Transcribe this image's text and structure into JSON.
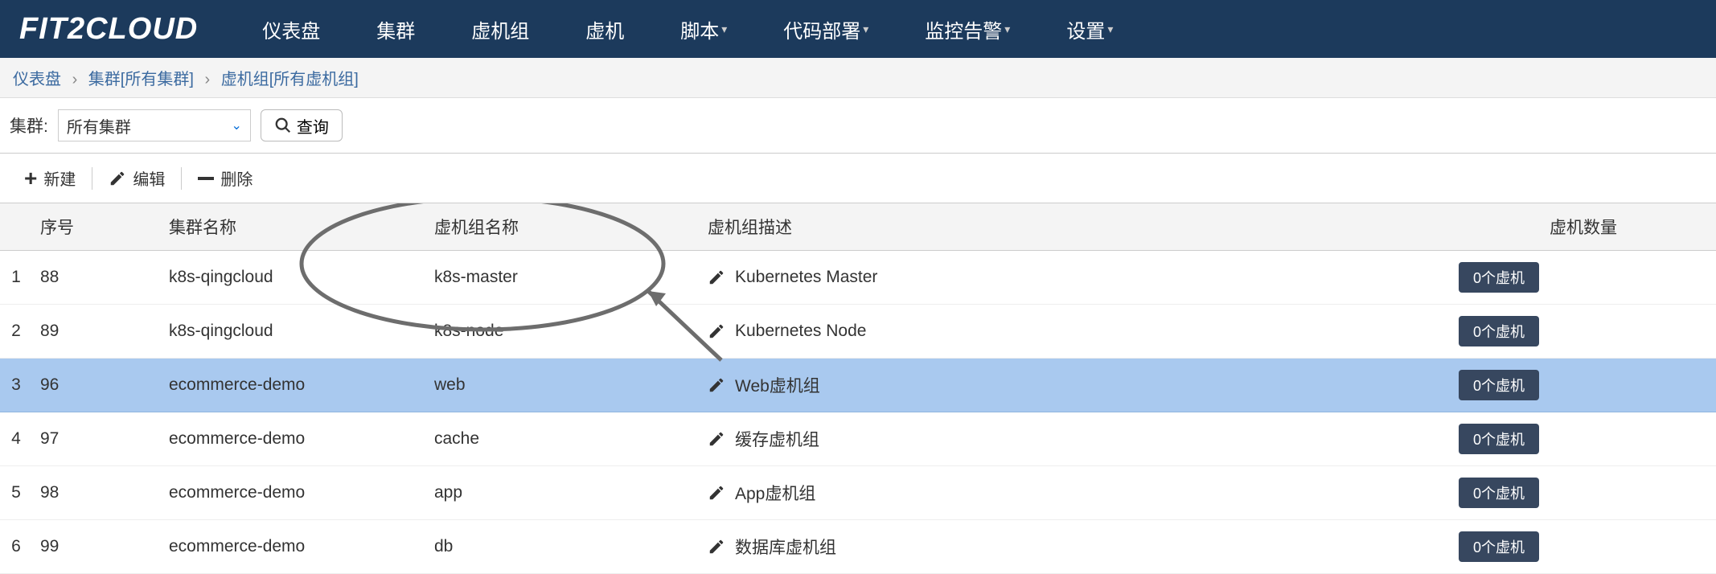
{
  "brand": "FIT2CLOUD",
  "nav": [
    "仪表盘",
    "集群",
    "虚机组",
    "虚机",
    "脚本",
    "代码部署",
    "监控告警",
    "设置"
  ],
  "nav_dropdowns": [
    false,
    false,
    false,
    false,
    true,
    true,
    true,
    true
  ],
  "breadcrumb": [
    "仪表盘",
    "集群[所有集群]",
    "虚机组[所有虚机组]"
  ],
  "filter": {
    "label": "集群:",
    "selected": "所有集群",
    "search_btn": "查询"
  },
  "toolbar": {
    "new": "新建",
    "edit": "编辑",
    "delete": "删除"
  },
  "columns": {
    "seq": "序号",
    "cluster": "集群名称",
    "vmgroup": "虚机组名称",
    "desc": "虚机组描述",
    "count": "虚机数量"
  },
  "rows": [
    {
      "idx": "1",
      "seq": "88",
      "cluster": "k8s-qingcloud",
      "vmgroup": "k8s-master",
      "desc": "Kubernetes Master",
      "count": "0个虚机",
      "selected": false
    },
    {
      "idx": "2",
      "seq": "89",
      "cluster": "k8s-qingcloud",
      "vmgroup": "k8s-node",
      "desc": "Kubernetes Node",
      "count": "0个虚机",
      "selected": false
    },
    {
      "idx": "3",
      "seq": "96",
      "cluster": "ecommerce-demo",
      "vmgroup": "web",
      "desc": "Web虚机组",
      "count": "0个虚机",
      "selected": true
    },
    {
      "idx": "4",
      "seq": "97",
      "cluster": "ecommerce-demo",
      "vmgroup": "cache",
      "desc": "缓存虚机组",
      "count": "0个虚机",
      "selected": false
    },
    {
      "idx": "5",
      "seq": "98",
      "cluster": "ecommerce-demo",
      "vmgroup": "app",
      "desc": "App虚机组",
      "count": "0个虚机",
      "selected": false
    },
    {
      "idx": "6",
      "seq": "99",
      "cluster": "ecommerce-demo",
      "vmgroup": "db",
      "desc": "数据库虚机组",
      "count": "0个虚机",
      "selected": false
    }
  ]
}
